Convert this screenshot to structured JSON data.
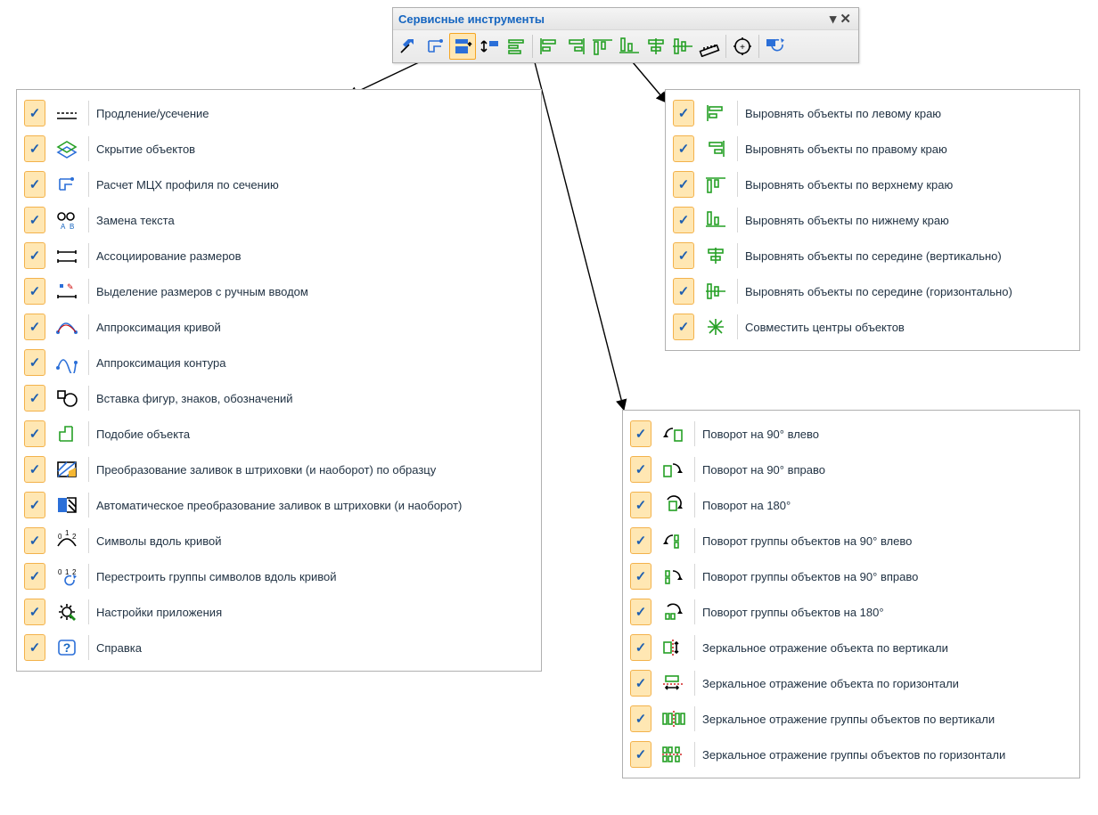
{
  "toolbar": {
    "title": "Сервисные инструменты",
    "buttons": [
      {
        "name": "tools-icon"
      },
      {
        "name": "profile-calc-icon"
      },
      {
        "name": "align-menu-icon",
        "selected": true
      },
      {
        "name": "rotate-menu-icon"
      },
      {
        "name": "align-list-icon"
      },
      {
        "name": "sep"
      },
      {
        "name": "align-left-icon"
      },
      {
        "name": "align-right-icon"
      },
      {
        "name": "align-top-icon"
      },
      {
        "name": "align-bottom-icon"
      },
      {
        "name": "align-vcenter-icon"
      },
      {
        "name": "align-hcenter-icon"
      },
      {
        "name": "measure-icon"
      },
      {
        "name": "sep"
      },
      {
        "name": "target-icon"
      },
      {
        "name": "sep"
      },
      {
        "name": "refresh-icon"
      }
    ]
  },
  "panelLeft": {
    "items": [
      {
        "label": "Продление/усечение",
        "icon": "extend-trim-icon"
      },
      {
        "label": "Скрытие объектов",
        "icon": "hide-objects-icon"
      },
      {
        "label": "Расчет МЦХ профиля по сечению",
        "icon": "profile-calc-icon"
      },
      {
        "label": "Замена текста",
        "icon": "replace-text-icon"
      },
      {
        "label": "Ассоциирование размеров",
        "icon": "associate-dims-icon"
      },
      {
        "label": "Выделение размеров с ручным вводом",
        "icon": "select-manual-dims-icon"
      },
      {
        "label": "Аппроксимация кривой",
        "icon": "approx-curve-icon"
      },
      {
        "label": "Аппроксимация контура",
        "icon": "approx-contour-icon"
      },
      {
        "label": "Вставка фигур, знаков, обозначений",
        "icon": "insert-shapes-icon"
      },
      {
        "label": "Подобие объекта",
        "icon": "similar-object-icon"
      },
      {
        "label": "Преобразование заливок в штриховки (и наоборот) по образцу",
        "icon": "hatch-convert-sample-icon"
      },
      {
        "label": "Автоматическое преобразование заливок в штриховки (и наоборот)",
        "icon": "hatch-convert-auto-icon"
      },
      {
        "label": "Символы вдоль кривой",
        "icon": "symbols-along-curve-icon"
      },
      {
        "label": "Перестроить группы символов вдоль кривой",
        "icon": "rebuild-symbols-icon"
      },
      {
        "label": "Настройки приложения",
        "icon": "settings-icon"
      },
      {
        "label": "Справка",
        "icon": "help-icon"
      }
    ]
  },
  "panelAlign": {
    "items": [
      {
        "label": "Выровнять объекты по левому краю",
        "icon": "align-left-icon"
      },
      {
        "label": "Выровнять объекты по правому краю",
        "icon": "align-right-icon"
      },
      {
        "label": "Выровнять объекты по верхнему краю",
        "icon": "align-top-icon"
      },
      {
        "label": "Выровнять объекты по нижнему краю",
        "icon": "align-bottom-icon"
      },
      {
        "label": "Выровнять объекты по середине (вертикально)",
        "icon": "align-vcenter-icon"
      },
      {
        "label": "Выровнять объекты по середине (горизонтально)",
        "icon": "align-hcenter-icon"
      },
      {
        "label": "Совместить центры объектов",
        "icon": "align-centers-icon"
      }
    ]
  },
  "panelRotate": {
    "items": [
      {
        "label": "Поворот на 90° влево",
        "icon": "rotate-90-left-icon"
      },
      {
        "label": "Поворот на 90° вправо",
        "icon": "rotate-90-right-icon"
      },
      {
        "label": "Поворот на 180°",
        "icon": "rotate-180-icon"
      },
      {
        "label": "Поворот группы объектов на 90° влево",
        "icon": "rotate-group-90-left-icon"
      },
      {
        "label": "Поворот группы объектов на 90° вправо",
        "icon": "rotate-group-90-right-icon"
      },
      {
        "label": "Поворот группы объектов на 180°",
        "icon": "rotate-group-180-icon"
      },
      {
        "label": "Зеркальное отражение объекта по вертикали",
        "icon": "mirror-obj-v-icon"
      },
      {
        "label": "Зеркальное отражение объекта по горизонтали",
        "icon": "mirror-obj-h-icon"
      },
      {
        "label": "Зеркальное отражение группы объектов по вертикали",
        "icon": "mirror-group-v-icon"
      },
      {
        "label": "Зеркальное отражение группы объектов по горизонтали",
        "icon": "mirror-group-h-icon"
      }
    ]
  }
}
